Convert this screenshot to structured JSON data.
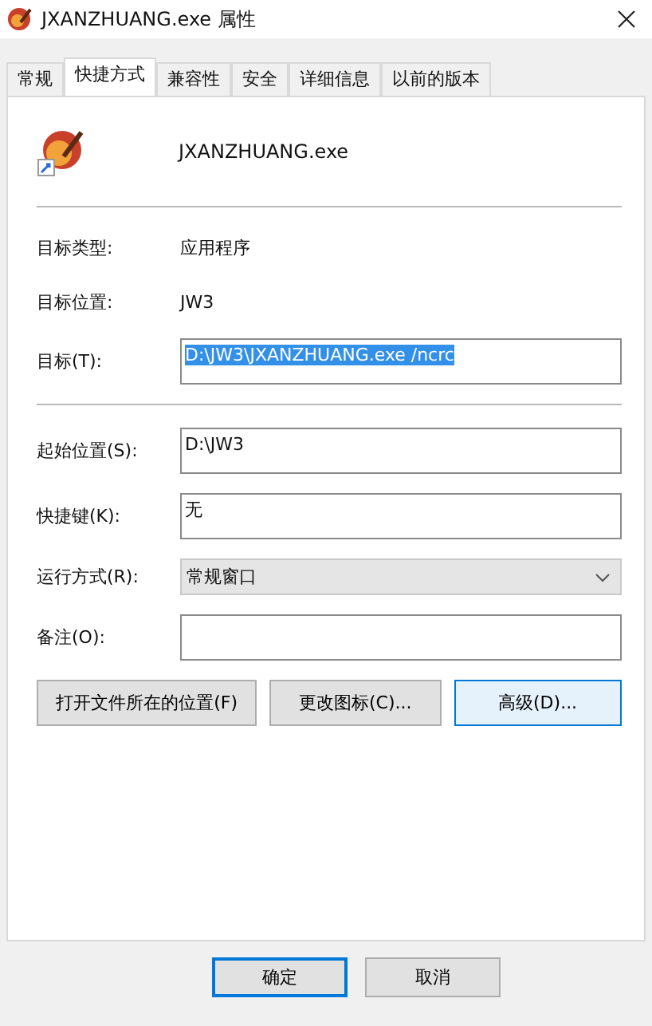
{
  "window": {
    "title": "JXANZHUANG.exe 属性"
  },
  "tabs": [
    {
      "label": "常规",
      "selected": false
    },
    {
      "label": "快捷方式",
      "selected": true
    },
    {
      "label": "兼容性",
      "selected": false
    },
    {
      "label": "安全",
      "selected": false
    },
    {
      "label": "详细信息",
      "selected": false
    },
    {
      "label": "以前的版本",
      "selected": false
    }
  ],
  "file_name": "JXANZHUANG.exe",
  "info_rows": [
    {
      "kind": "text",
      "label": "目标类型:",
      "value": "应用程序"
    },
    {
      "kind": "text",
      "label": "目标位置:",
      "value": "JW3"
    },
    {
      "kind": "field",
      "label": "目标(T):",
      "value": "D:\\JW3\\JXANZHUANG.exe /ncrc",
      "text_selected": true
    }
  ],
  "settings_rows": [
    {
      "kind": "field",
      "label": "起始位置(S):",
      "value": "D:\\JW3",
      "text_selected": false
    },
    {
      "kind": "field",
      "label": "快捷键(K):",
      "value": "无",
      "text_selected": false
    },
    {
      "kind": "dropdown",
      "label": "运行方式(R):",
      "value": "常规窗口"
    },
    {
      "kind": "field",
      "label": "备注(O):"
    }
  ],
  "action_buttons": [
    {
      "label": "打开文件所在的位置(F)",
      "focused": false
    },
    {
      "label": "更改图标(C)...",
      "focused": false
    },
    {
      "label": "高级(D)...",
      "focused": true
    }
  ],
  "dialog_buttons": [
    {
      "label": "确定",
      "default": true
    },
    {
      "label": "取消",
      "default": false
    }
  ]
}
